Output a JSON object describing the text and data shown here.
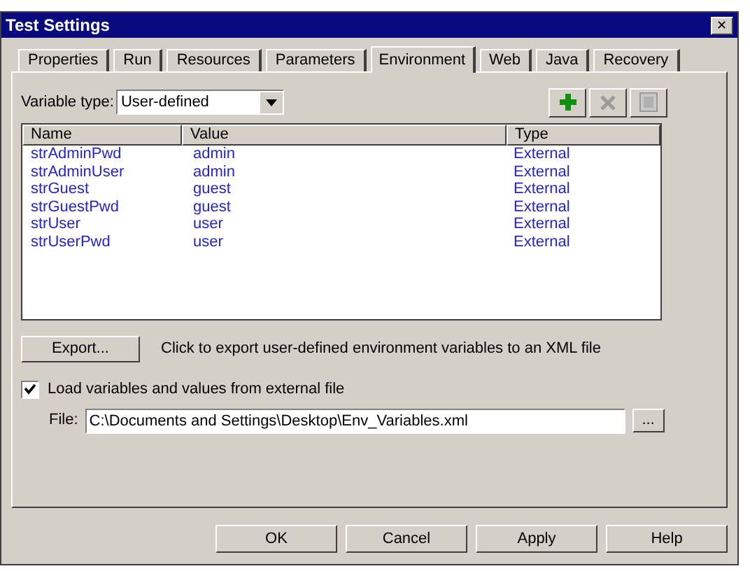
{
  "window": {
    "title": "Test Settings",
    "close": "✕"
  },
  "tabs": [
    {
      "label": "Properties",
      "selected": false
    },
    {
      "label": "Run",
      "selected": false
    },
    {
      "label": "Resources",
      "selected": false
    },
    {
      "label": "Parameters",
      "selected": false
    },
    {
      "label": "Environment",
      "selected": true
    },
    {
      "label": "Web",
      "selected": false
    },
    {
      "label": "Java",
      "selected": false
    },
    {
      "label": "Recovery",
      "selected": false
    }
  ],
  "variable_type": {
    "label": "Variable type:",
    "value": "User-defined"
  },
  "toolbar": [
    {
      "kind": "add",
      "disabled": false
    },
    {
      "kind": "delete",
      "disabled": true
    },
    {
      "kind": "details",
      "disabled": true
    }
  ],
  "table": {
    "columns": [
      "Name",
      "Value",
      "Type"
    ],
    "rows": [
      [
        "strAdminPwd",
        "admin",
        "External"
      ],
      [
        "strAdminUser",
        "admin",
        "External"
      ],
      [
        "strGuest",
        "guest",
        "External"
      ],
      [
        "strGuestPwd",
        "guest",
        "External"
      ],
      [
        "strUser",
        "user",
        "External"
      ],
      [
        "strUserPwd",
        "user",
        "External"
      ]
    ]
  },
  "export": {
    "button": "Export...",
    "description": "Click to export user-defined environment variables to an XML file"
  },
  "load_external": {
    "label": "Load variables and values from external file",
    "checked": true
  },
  "file": {
    "label": "File:",
    "value": "C:\\Documents and Settings\\Desktop\\Env_Variables.xml",
    "browse": "..."
  },
  "buttons": [
    "OK",
    "Cancel",
    "Apply",
    "Help"
  ]
}
